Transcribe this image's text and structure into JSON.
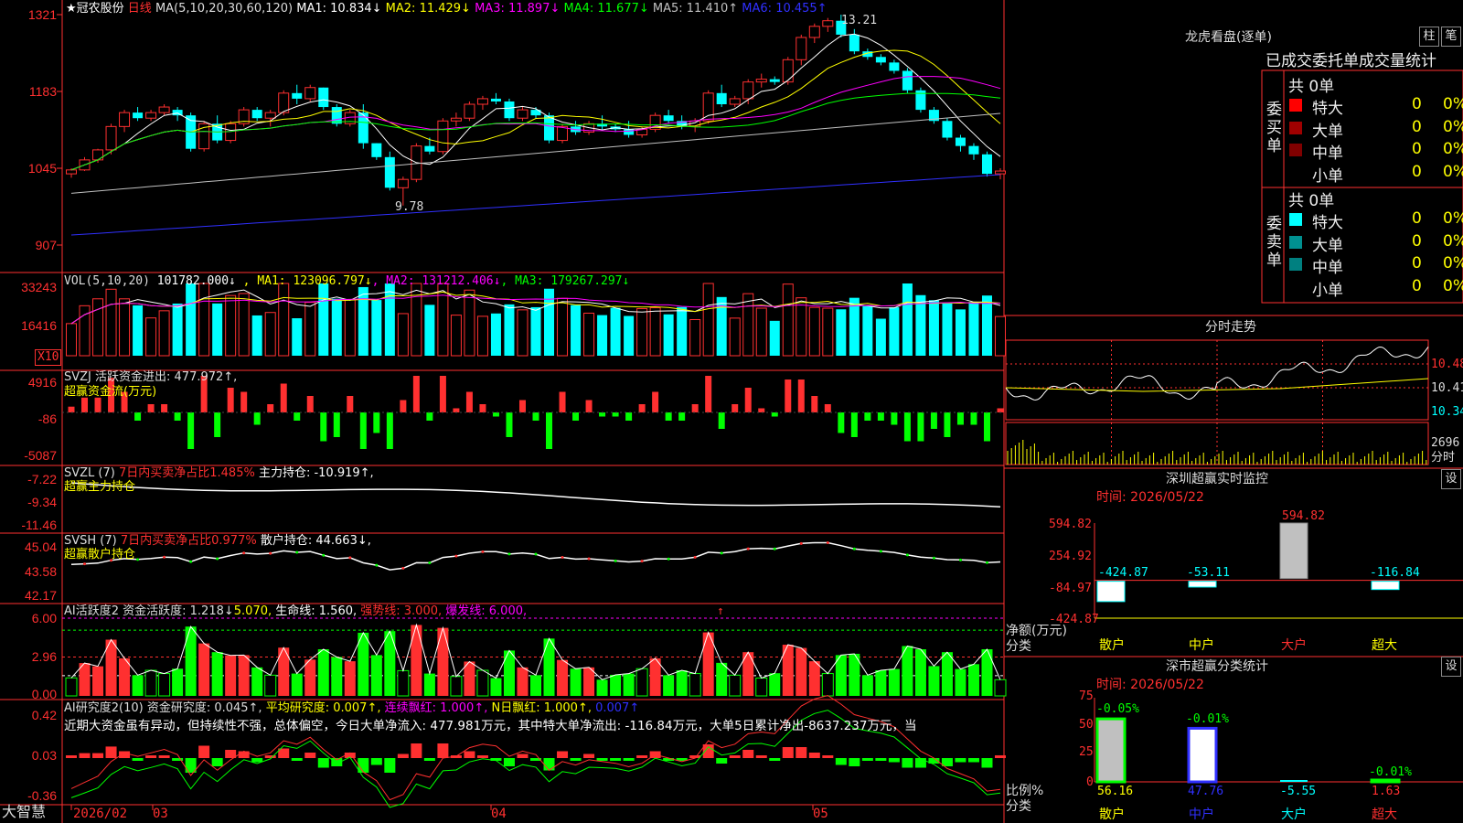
{
  "stock": {
    "name": "★冠农股份",
    "period": "日线"
  },
  "main": {
    "ma_params": "MA(5,10,20,30,60,120)",
    "ma_items": [
      {
        "label": "MA1: 10.834↓",
        "color": "#ffffff"
      },
      {
        "label": "MA2: 11.429↓",
        "color": "#ffff00"
      },
      {
        "label": "MA3: 11.897↓",
        "color": "#ff00ff"
      },
      {
        "label": "MA4: 11.677↓",
        "color": "#00ff00"
      },
      {
        "label": "MA5: 11.410↑",
        "color": "#c0c0c0"
      },
      {
        "label": "MA6: 10.455↑",
        "color": "#3030ff"
      }
    ],
    "y_ticks": [
      "1321",
      "1183",
      "1045",
      "907"
    ],
    "high_mark": "13.21",
    "low_mark": "9.78"
  },
  "vol": {
    "params": "VOL(5,10,20)",
    "value": "101782.000↓",
    "items": [
      {
        "label": "MA1: 123096.797↓",
        "color": "#ffff00"
      },
      {
        "label": "MA2: 131212.406↓",
        "color": "#ff00ff"
      },
      {
        "label": "MA3: 179267.297↓",
        "color": "#00ff00"
      }
    ],
    "y_ticks": [
      "33243",
      "16416"
    ],
    "unit": "X10"
  },
  "svzj": {
    "label": "SVZJ  活跃资金进出: 477.972↑,",
    "sub": "超赢资金流(万元)",
    "y_ticks": [
      "4916",
      "-86",
      "-5087"
    ]
  },
  "svzl": {
    "label": "SVZL (7) ",
    "pct": "7日内买卖净占比1.485%",
    "main": " 主力持仓: -10.919↑,",
    "sub": "超赢主力持仓",
    "y_ticks": [
      "-7.22",
      "-9.34",
      "-11.46"
    ]
  },
  "svsh": {
    "label": "SVSH (7) ",
    "pct": "7日内买卖净占比0.977%",
    "main": " 散户持仓: 44.663↓,",
    "sub": "超赢散户持仓",
    "y_ticks": [
      "45.04",
      "43.58",
      "42.17"
    ]
  },
  "ai1": {
    "label": "AI活跃度2 资金活跃度: 1.218↓",
    "v2": "5.070,",
    "v3": " 生命线: 1.560,",
    "v4": " 强势线: 3.000,",
    "v5": " 爆发线: 6.000,",
    "arrow": "↑",
    "y_ticks": [
      "6.00",
      "2.96",
      "0.00"
    ]
  },
  "ai2": {
    "label": "AI研究度2(10) 资金研究度: 0.045↑,",
    "v2": " 平均研究度: 0.007↑,",
    "v3": " 连续飘红: 1.000↑,",
    "v4": " N日飘红: 1.000↑,",
    "v5": " 0.007↑",
    "text": "近期大资金虽有异动，但持续性不强，总体偏空，今日大单净流入: 477.981万元，其中特大单净流出: -116.84万元，大单5日累计净出-8637.237万元，当",
    "y_ticks": [
      "0.42",
      "0.03",
      "-0.36"
    ]
  },
  "xaxis": {
    "brand": "大智慧",
    "labels": [
      "2026/02",
      "03",
      "04",
      "05"
    ]
  },
  "dragon": {
    "title": "龙虎看盘(逐单)",
    "btn1": "柱",
    "btn2": "笔",
    "tabs": [
      "已成交",
      "委托单",
      "成交量统计"
    ],
    "buy": {
      "side": "委买单",
      "total": "共 0单",
      "rows": [
        {
          "name": "特大",
          "val": "0",
          "pct": "0%",
          "color": "#ff0000"
        },
        {
          "name": "大单",
          "val": "0",
          "pct": "0%",
          "color": "#a00000"
        },
        {
          "name": "中单",
          "val": "0",
          "pct": "0%",
          "color": "#800000"
        },
        {
          "name": "小单",
          "val": "0",
          "pct": "0%",
          "color": ""
        }
      ]
    },
    "sell": {
      "side": "委卖单",
      "total": "共 0单",
      "rows": [
        {
          "name": "特大",
          "val": "0",
          "pct": "0%",
          "color": "#00ffff"
        },
        {
          "name": "大单",
          "val": "0",
          "pct": "0%",
          "color": "#009090"
        },
        {
          "name": "中单",
          "val": "0",
          "pct": "0%",
          "color": "#008080"
        },
        {
          "name": "小单",
          "val": "0",
          "pct": "0%",
          "color": ""
        }
      ]
    }
  },
  "minute": {
    "title": "分时走势",
    "y_ticks": [
      "10.48",
      "10.41",
      "10.34"
    ],
    "vol_tick": "2696",
    "vol_unit": "分时"
  },
  "sz_monitor": {
    "title": "深圳超赢实时监控",
    "btn": "设",
    "time": "时间: 2026/05/22",
    "y_ticks": [
      "594.82",
      "254.92",
      "-84.97",
      "-424.87"
    ],
    "ylabel": "净额(万元)",
    "xlabel": "分类",
    "cats": [
      "散户",
      "中户",
      "大户",
      "超大"
    ],
    "values": [
      -424.87,
      -53.11,
      594.82,
      -116.84
    ],
    "value_labels": [
      "-424.87",
      "-53.11",
      "594.82",
      "-116.84"
    ]
  },
  "sz_class": {
    "title": "深市超赢分类统计",
    "btn": "设",
    "time": "时间: 2026/05/22",
    "y_ticks": [
      "75",
      "50",
      "25",
      "0"
    ],
    "ylabel": "比例%",
    "xlabel": "分类",
    "cats": [
      "散户",
      "中户",
      "大户",
      "超大"
    ],
    "values": [
      56.16,
      47.76,
      -5.55,
      1.63
    ],
    "value_labels": [
      "56.16",
      "47.76",
      "-5.55",
      "1.63"
    ],
    "delta_labels": [
      "-0.05%",
      "-0.01%",
      "",
      "-0.01%"
    ]
  },
  "chart_data": [
    {
      "type": "candlestick",
      "title": "★冠农股份 日线",
      "ylim": [
        9.07,
        13.21
      ],
      "y_ticks": [
        13.21,
        11.83,
        10.45,
        9.07
      ],
      "x_labels": [
        "2026/02",
        "03",
        "04",
        "05"
      ],
      "high": 13.21,
      "low": 9.78,
      "ohlc": [
        [
          10.35,
          10.45,
          10.28,
          10.42
        ],
        [
          10.42,
          10.65,
          10.4,
          10.6
        ],
        [
          10.6,
          10.8,
          10.55,
          10.78
        ],
        [
          10.78,
          11.25,
          10.7,
          11.2
        ],
        [
          11.2,
          11.5,
          11.1,
          11.45
        ],
        [
          11.45,
          11.55,
          11.3,
          11.35
        ],
        [
          11.35,
          11.5,
          11.3,
          11.45
        ],
        [
          11.45,
          11.6,
          11.4,
          11.55
        ],
        [
          11.5,
          11.55,
          11.3,
          11.4
        ],
        [
          11.4,
          11.45,
          10.75,
          10.8
        ],
        [
          10.8,
          11.3,
          10.75,
          11.25
        ],
        [
          11.25,
          11.4,
          10.9,
          10.95
        ],
        [
          10.95,
          11.3,
          10.9,
          11.25
        ],
        [
          11.25,
          11.55,
          11.2,
          11.5
        ],
        [
          11.5,
          11.55,
          11.3,
          11.35
        ],
        [
          11.35,
          11.5,
          11.2,
          11.45
        ],
        [
          11.45,
          11.85,
          11.4,
          11.8
        ],
        [
          11.8,
          11.95,
          11.6,
          11.7
        ],
        [
          11.7,
          11.95,
          11.65,
          11.9
        ],
        [
          11.9,
          11.9,
          11.5,
          11.55
        ],
        [
          11.55,
          11.6,
          11.2,
          11.25
        ],
        [
          11.25,
          11.5,
          11.2,
          11.45
        ],
        [
          11.45,
          11.6,
          10.8,
          10.9
        ],
        [
          10.9,
          10.9,
          10.6,
          10.65
        ],
        [
          10.65,
          10.75,
          10.05,
          10.1
        ],
        [
          10.1,
          10.3,
          9.78,
          10.25
        ],
        [
          10.25,
          10.9,
          10.2,
          10.85
        ],
        [
          10.85,
          11.0,
          10.7,
          10.75
        ],
        [
          10.75,
          11.35,
          10.7,
          11.3
        ],
        [
          11.3,
          11.45,
          11.2,
          11.35
        ],
        [
          11.35,
          11.65,
          11.3,
          11.6
        ],
        [
          11.6,
          11.75,
          11.5,
          11.7
        ],
        [
          11.7,
          11.8,
          11.6,
          11.65
        ],
        [
          11.65,
          11.7,
          11.3,
          11.35
        ],
        [
          11.35,
          11.55,
          11.3,
          11.5
        ],
        [
          11.5,
          11.55,
          11.35,
          11.4
        ],
        [
          11.4,
          11.45,
          10.9,
          10.95
        ],
        [
          10.95,
          11.25,
          10.9,
          11.2
        ],
        [
          11.2,
          11.3,
          11.05,
          11.1
        ],
        [
          11.1,
          11.3,
          11.05,
          11.25
        ],
        [
          11.25,
          11.4,
          11.15,
          11.2
        ],
        [
          11.2,
          11.25,
          11.1,
          11.15
        ],
        [
          11.15,
          11.3,
          11.0,
          11.05
        ],
        [
          11.05,
          11.2,
          11.0,
          11.15
        ],
        [
          11.15,
          11.45,
          11.1,
          11.4
        ],
        [
          11.4,
          11.5,
          11.25,
          11.3
        ],
        [
          11.3,
          11.4,
          11.15,
          11.2
        ],
        [
          11.2,
          11.35,
          11.1,
          11.3
        ],
        [
          11.3,
          11.85,
          11.25,
          11.8
        ],
        [
          11.8,
          11.95,
          11.55,
          11.6
        ],
        [
          11.6,
          11.75,
          11.55,
          11.7
        ],
        [
          11.7,
          12.05,
          11.6,
          12.0
        ],
        [
          12.0,
          12.15,
          11.9,
          12.05
        ],
        [
          12.05,
          12.1,
          11.95,
          12.0
        ],
        [
          12.0,
          12.45,
          11.95,
          12.4
        ],
        [
          12.4,
          12.85,
          12.3,
          12.8
        ],
        [
          12.8,
          13.05,
          12.7,
          13.0
        ],
        [
          13.0,
          13.15,
          12.9,
          13.1
        ],
        [
          13.1,
          13.21,
          12.8,
          12.85
        ],
        [
          12.85,
          12.95,
          12.5,
          12.55
        ],
        [
          12.55,
          12.6,
          12.4,
          12.45
        ],
        [
          12.45,
          12.5,
          12.3,
          12.35
        ],
        [
          12.35,
          12.4,
          12.15,
          12.2
        ],
        [
          12.2,
          12.25,
          11.8,
          11.85
        ],
        [
          11.85,
          11.9,
          11.45,
          11.5
        ],
        [
          11.5,
          11.55,
          11.25,
          11.3
        ],
        [
          11.3,
          11.35,
          10.95,
          11.0
        ],
        [
          11.0,
          11.05,
          10.75,
          10.85
        ],
        [
          10.85,
          10.9,
          10.6,
          10.7
        ],
        [
          10.7,
          10.75,
          10.3,
          10.35
        ],
        [
          10.35,
          10.45,
          10.25,
          10.4
        ]
      ]
    },
    {
      "type": "bar",
      "title": "VOL(5,10,20)",
      "y_ticks": [
        33243,
        16416
      ],
      "unit": "X10"
    },
    {
      "type": "bar",
      "title": "SVZJ 活跃资金进出",
      "y_ticks": [
        4916,
        -86,
        -5087
      ],
      "last": 477.972
    },
    {
      "type": "line",
      "title": "SVZL 主力持仓",
      "y_ticks": [
        -7.22,
        -9.34,
        -11.46
      ],
      "last": -10.919
    },
    {
      "type": "line",
      "title": "SVSH 散户持仓",
      "y_ticks": [
        45.04,
        43.58,
        42.17
      ],
      "last": 44.663
    },
    {
      "type": "bar",
      "title": "AI活跃度2",
      "y_ticks": [
        6.0,
        2.96,
        0.0
      ],
      "lines": {
        "强势线": 3.0,
        "爆发线": 6.0,
        "生命线": 1.56
      }
    },
    {
      "type": "bar",
      "title": "AI研究度2(10)",
      "y_ticks": [
        0.42,
        0.03,
        -0.36
      ]
    },
    {
      "type": "bar",
      "title": "深圳超赢实时监控",
      "categories": [
        "散户",
        "中户",
        "大户",
        "超大"
      ],
      "values": [
        -424.87,
        -53.11,
        594.82,
        -116.84
      ],
      "ylabel": "净额(万元)",
      "xlabel": "分类",
      "y_ticks": [
        594.82,
        254.92,
        -84.97,
        -424.87
      ]
    },
    {
      "type": "bar",
      "title": "深市超赢分类统计",
      "categories": [
        "散户",
        "中户",
        "大户",
        "超大"
      ],
      "values": [
        56.16,
        47.76,
        -5.55,
        1.63
      ],
      "ylabel": "比例%",
      "xlabel": "分类",
      "ylim": [
        0,
        75
      ]
    }
  ]
}
